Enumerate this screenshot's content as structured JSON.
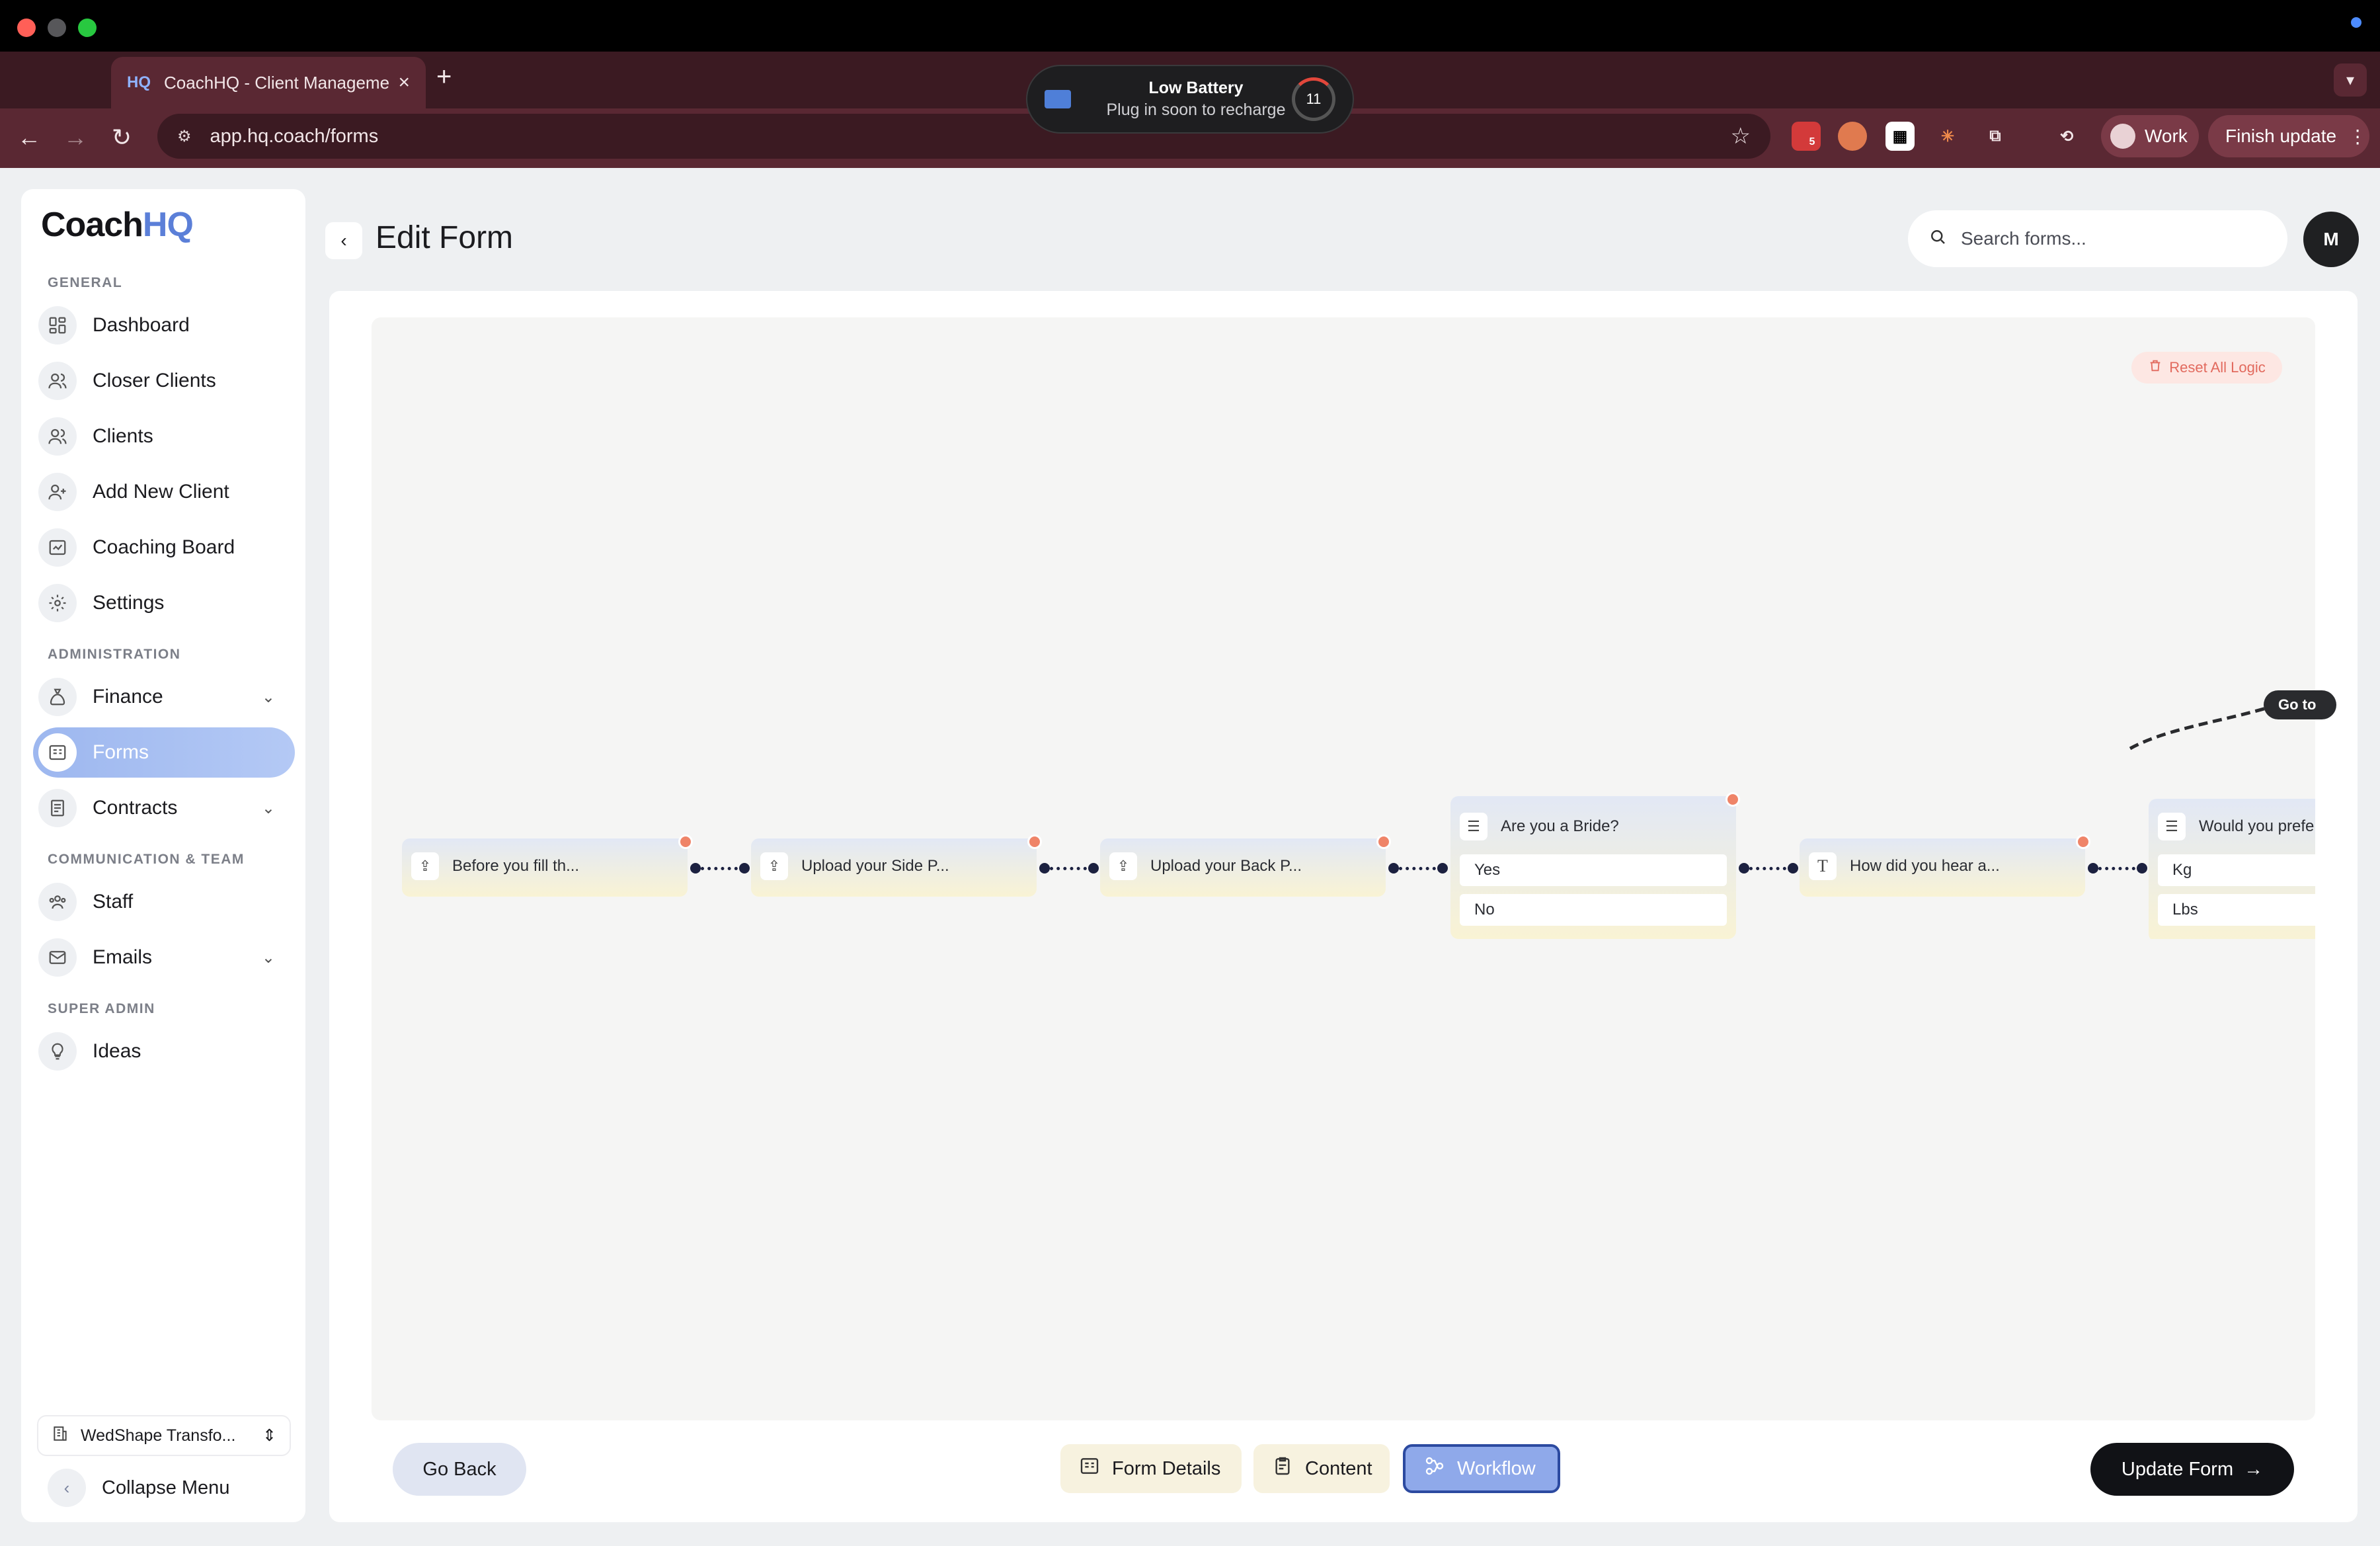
{
  "browser": {
    "tab_icon_text": "HQ",
    "tab_title": "CoachHQ - Client Manageme",
    "close_glyph": "×",
    "new_tab_glyph": "+",
    "url": "app.hq.coach/forms",
    "ext_badge_count": "5",
    "profile_label": "Work",
    "finish_update_label": "Finish update"
  },
  "battery_toast": {
    "title": "Low Battery",
    "subtitle": "Plug in soon to recharge",
    "percent": "11"
  },
  "sidebar": {
    "logo_main": "Coach",
    "logo_accent": "HQ",
    "sections": {
      "general": "GENERAL",
      "administration": "ADMINISTRATION",
      "communication": "COMMUNICATION & TEAM",
      "super_admin": "SUPER ADMIN"
    },
    "items": [
      {
        "label": "Dashboard",
        "icon": "dashboard-icon"
      },
      {
        "label": "Closer Clients",
        "icon": "users-icon"
      },
      {
        "label": "Clients",
        "icon": "users-icon"
      },
      {
        "label": "Add New Client",
        "icon": "user-plus-icon"
      },
      {
        "label": "Coaching Board",
        "icon": "board-icon"
      },
      {
        "label": "Settings",
        "icon": "gear-icon"
      },
      {
        "label": "Finance",
        "icon": "money-bag-icon"
      },
      {
        "label": "Forms",
        "icon": "form-icon",
        "active": true
      },
      {
        "label": "Contracts",
        "icon": "contract-icon"
      },
      {
        "label": "Staff",
        "icon": "team-icon"
      },
      {
        "label": "Emails",
        "icon": "mail-icon"
      },
      {
        "label": "Ideas",
        "icon": "lightbulb-icon"
      }
    ],
    "workspace_label": "WedShape Transfo...",
    "collapse_label": "Collapse Menu"
  },
  "header": {
    "title": "Edit Form",
    "search_placeholder": "Search forms...",
    "avatar_initial": "M"
  },
  "workflow": {
    "reset_label": "Reset All Logic",
    "goto_label": "Go to",
    "nodes": [
      {
        "label": "Before you fill th...",
        "icon": "upload-icon"
      },
      {
        "label": "Upload your Side P...",
        "icon": "upload-icon"
      },
      {
        "label": "Upload your Back P...",
        "icon": "upload-icon"
      },
      {
        "label": "Are you a Bride?",
        "icon": "checklist-icon",
        "options": [
          "Yes",
          "No"
        ]
      },
      {
        "label": "How did you hear a...",
        "icon": "text-icon"
      },
      {
        "label": "Would you prefe",
        "icon": "checklist-icon",
        "options": [
          "Kg",
          "Lbs"
        ]
      }
    ]
  },
  "footer": {
    "go_back_label": "Go Back",
    "tabs": {
      "details": "Form Details",
      "content": "Content",
      "workflow": "Workflow"
    },
    "update_label": "Update Form"
  },
  "colors": {
    "accent": "#5b7fd8",
    "active_nav": "#9db7ef",
    "workflow_tab": "#8fa9ea",
    "handle": "#ef8468",
    "connector": "#1c2140"
  }
}
